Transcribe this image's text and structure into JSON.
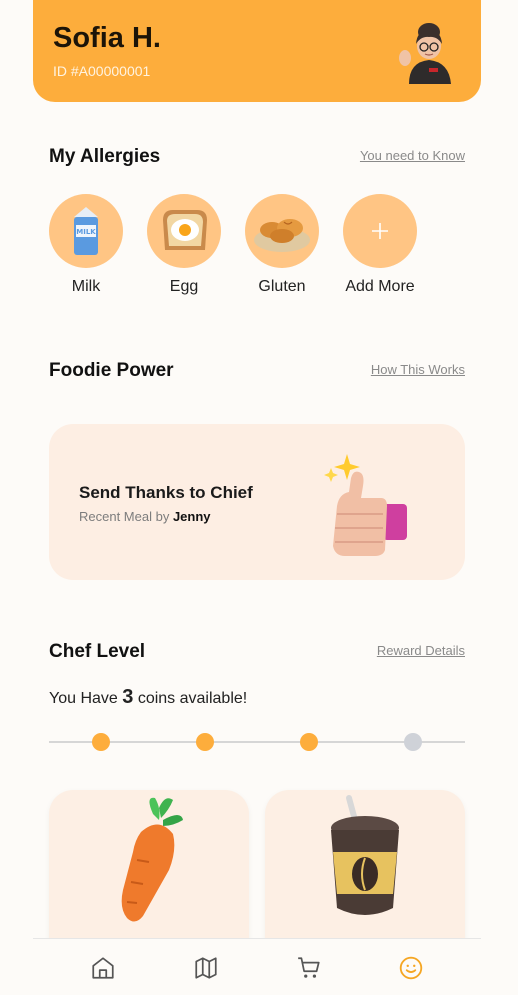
{
  "profile": {
    "name": "Sofia H.",
    "id": "ID #A00000001"
  },
  "allergies": {
    "title": "My Allergies",
    "link": "You need to Know",
    "items": [
      {
        "label": "Milk",
        "icon": "milk-carton-icon"
      },
      {
        "label": "Egg",
        "icon": "fried-egg-icon"
      },
      {
        "label": "Gluten",
        "icon": "croissant-bread-icon"
      },
      {
        "label": "Add More",
        "icon": "plus-icon"
      }
    ]
  },
  "foodie": {
    "title": "Foodie Power",
    "link": "How This Works",
    "card_title": "Send Thanks to Chief",
    "card_sub_prefix": "Recent Meal by ",
    "card_sub_name": "Jenny"
  },
  "chef": {
    "title": "Chef Level",
    "link": "Reward Details",
    "coins_prefix": "You Have ",
    "coins_value": "3",
    "coins_suffix": " coins available!",
    "progress_steps_total": 4,
    "progress_steps_filled": 3,
    "rewards": [
      {
        "icon": "carrot-icon"
      },
      {
        "icon": "coffee-cup-icon"
      }
    ]
  },
  "nav": {
    "items": [
      "home-icon",
      "map-icon",
      "cart-icon",
      "smile-icon"
    ],
    "active": "smile-icon"
  },
  "colors": {
    "accent": "#fdad3c",
    "allergy_circle": "#ffc584",
    "card_bg": "#fdeee3",
    "inactive_dot": "#cfd2d8"
  }
}
